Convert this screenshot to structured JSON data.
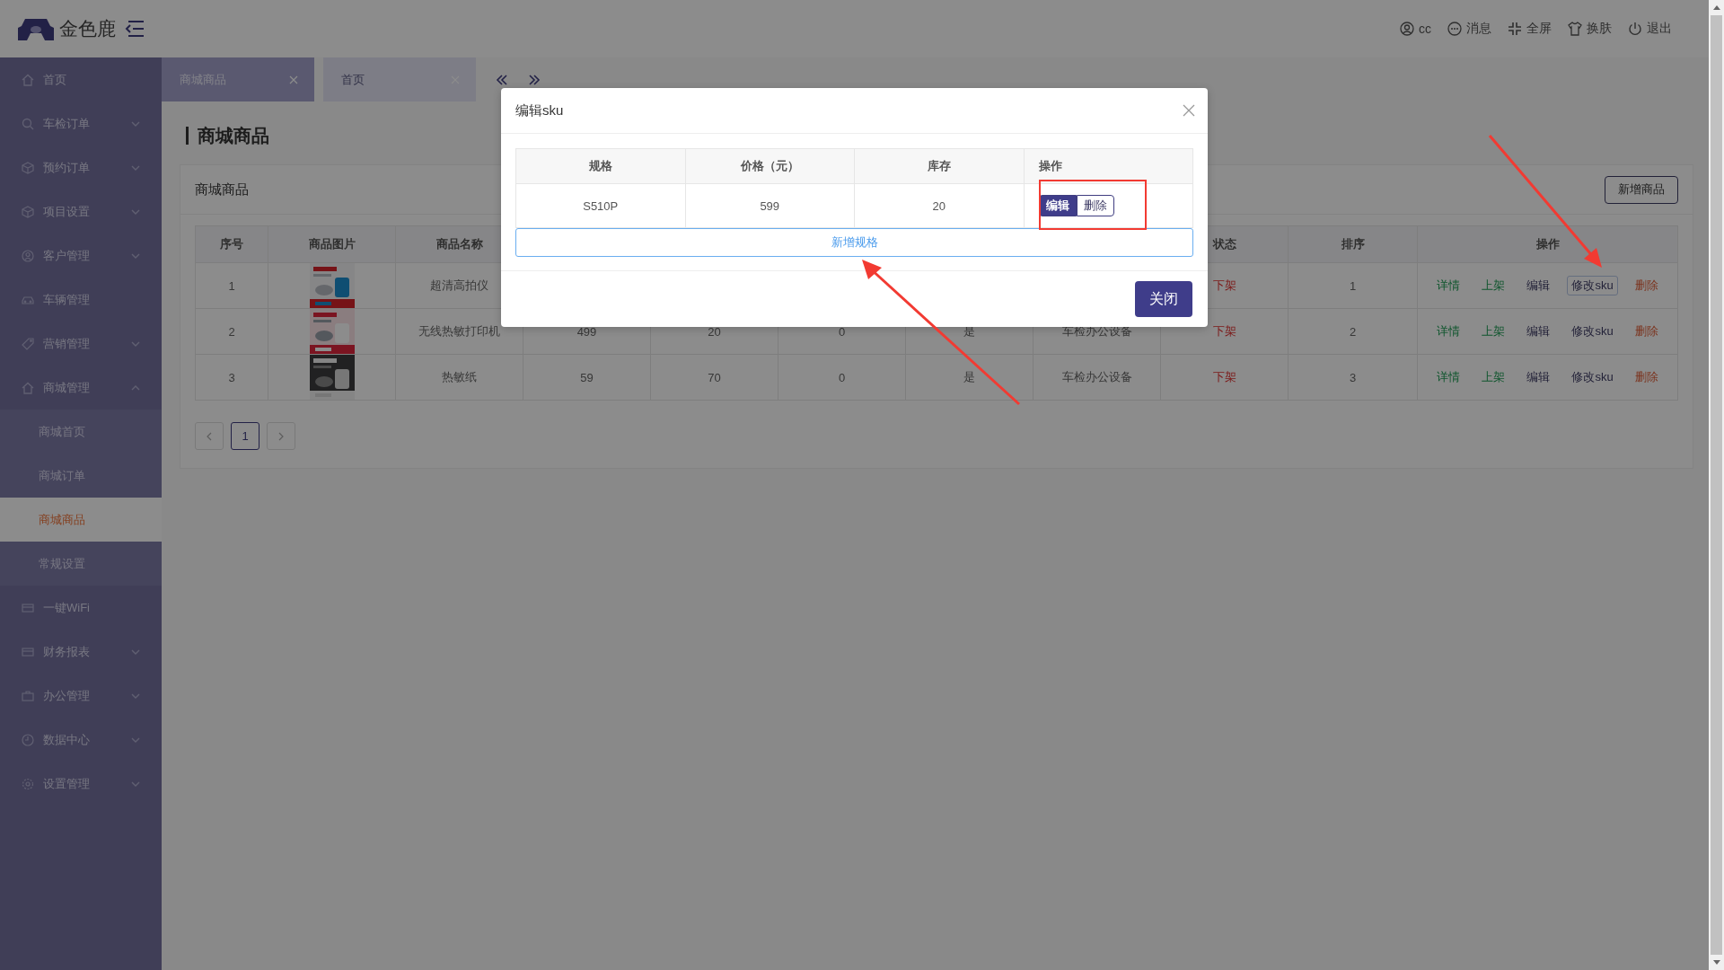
{
  "header": {
    "brand": "金色鹿",
    "items": [
      "cc",
      "消息",
      "全屏",
      "换肤",
      "退出"
    ]
  },
  "sidebar": {
    "items": [
      {
        "label": "首页",
        "kind": "link"
      },
      {
        "label": "车检订单",
        "kind": "group",
        "expanded": false
      },
      {
        "label": "预约订单",
        "kind": "group",
        "expanded": false
      },
      {
        "label": "项目设置",
        "kind": "group",
        "expanded": false
      },
      {
        "label": "客户管理",
        "kind": "group",
        "expanded": false
      },
      {
        "label": "车辆管理",
        "kind": "link"
      },
      {
        "label": "营销管理",
        "kind": "group",
        "expanded": false
      },
      {
        "label": "商城管理",
        "kind": "group",
        "expanded": true,
        "children": [
          {
            "label": "商城首页",
            "selected": false
          },
          {
            "label": "商城订单",
            "selected": false
          },
          {
            "label": "商城商品",
            "selected": true
          },
          {
            "label": "常规设置",
            "selected": false
          }
        ]
      },
      {
        "label": "一键WiFi",
        "kind": "link"
      },
      {
        "label": "财务报表",
        "kind": "group",
        "expanded": false
      },
      {
        "label": "办公管理",
        "kind": "group",
        "expanded": false
      },
      {
        "label": "数据中心",
        "kind": "group",
        "expanded": false
      },
      {
        "label": "设置管理",
        "kind": "group",
        "expanded": false
      }
    ]
  },
  "tabs": [
    {
      "label": "商城商品",
      "selected": true
    },
    {
      "label": "首页",
      "selected": false
    }
  ],
  "page_title": "商城商品",
  "card": {
    "title": "商城商品",
    "add_button": "新增商品"
  },
  "table": {
    "columns": [
      "序号",
      "商品图片",
      "商品名称",
      null,
      null,
      null,
      null,
      null,
      "状态",
      "排序",
      "操作"
    ],
    "rows": [
      {
        "index": "1",
        "name": "超清高拍仪",
        "cells": [
          null,
          null,
          null,
          null,
          null
        ],
        "status": "下架",
        "sort": "1",
        "actions": [
          {
            "label": "详情",
            "kind": "view"
          },
          {
            "label": "上架",
            "kind": "publish"
          },
          {
            "label": "编辑",
            "kind": "edit"
          },
          {
            "label": "修改sku",
            "kind": "sku",
            "focused": true
          },
          {
            "label": "删除",
            "kind": "delete"
          }
        ]
      },
      {
        "index": "2",
        "name": "无线热敏打印机",
        "cells": [
          "499",
          "20",
          "0",
          "是",
          "车检办公设备"
        ],
        "status": "下架",
        "sort": "2",
        "actions": [
          {
            "label": "详情",
            "kind": "view"
          },
          {
            "label": "上架",
            "kind": "publish"
          },
          {
            "label": "编辑",
            "kind": "edit"
          },
          {
            "label": "修改sku",
            "kind": "sku",
            "focused": false
          },
          {
            "label": "删除",
            "kind": "delete"
          }
        ]
      },
      {
        "index": "3",
        "name": "热敏纸",
        "cells": [
          "59",
          "70",
          "0",
          "是",
          "车检办公设备"
        ],
        "status": "下架",
        "sort": "3",
        "actions": [
          {
            "label": "详情",
            "kind": "view"
          },
          {
            "label": "上架",
            "kind": "publish"
          },
          {
            "label": "编辑",
            "kind": "edit"
          },
          {
            "label": "修改sku",
            "kind": "sku",
            "focused": false
          },
          {
            "label": "删除",
            "kind": "delete"
          }
        ]
      }
    ]
  },
  "pagination": {
    "pages": [
      {
        "label": "1",
        "selected": true
      }
    ]
  },
  "dialog": {
    "title": "编辑sku",
    "columns": [
      "规格",
      "价格（元）",
      "库存",
      "操作"
    ],
    "rows": [
      {
        "cells": [
          "S510P",
          "599",
          "20"
        ],
        "actions": [
          {
            "label": "编辑",
            "kind": "primary"
          },
          {
            "label": "删除",
            "kind": "plain"
          }
        ]
      }
    ],
    "add_button": "新增规格",
    "close_button": "关闭"
  }
}
